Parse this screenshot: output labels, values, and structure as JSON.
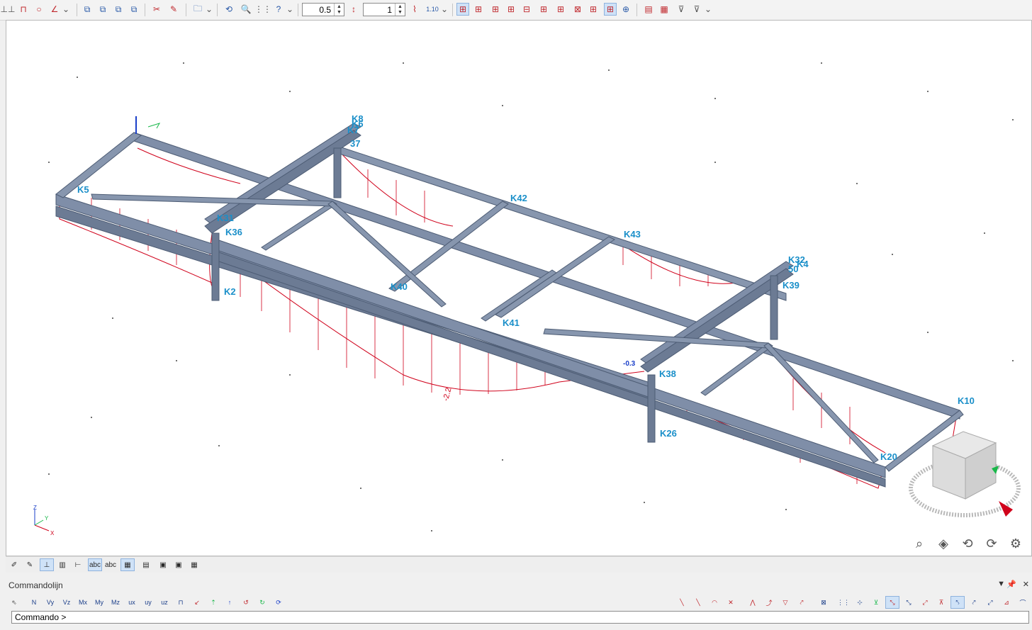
{
  "toolbar": {
    "scale_value": "0.5",
    "factor_value": "1",
    "factor_label": "1.10"
  },
  "model_labels": [
    {
      "text": "K8"
    },
    {
      "text": "K6"
    },
    {
      "text": "K7"
    },
    {
      "text": "37"
    },
    {
      "text": "K42"
    },
    {
      "text": "K43"
    },
    {
      "text": "K32"
    },
    {
      "text": "K4"
    },
    {
      "text": "50"
    },
    {
      "text": "K39"
    },
    {
      "text": "K31"
    },
    {
      "text": "K36"
    },
    {
      "text": "K2"
    },
    {
      "text": "K40"
    },
    {
      "text": "K41"
    },
    {
      "text": "K38"
    },
    {
      "text": "K26"
    },
    {
      "text": "K10"
    },
    {
      "text": "K20"
    },
    {
      "text": "K5"
    }
  ],
  "diagram_values": {
    "max_value": "-2.2",
    "end_value": "-0.3"
  },
  "axes": {
    "z": "Z",
    "y": "Y",
    "x": "X"
  },
  "command_panel": {
    "title": "Commandolijn",
    "prompt": "Commando >",
    "pin_icon": "pin-icon",
    "close_icon": "close-icon"
  },
  "command_buttons": [
    "N",
    "Vy",
    "Vz",
    "Mx",
    "My",
    "Mz",
    "ux",
    "uy",
    "uz"
  ],
  "colors": {
    "beam": "#7f8ea8",
    "beam_dark": "#56667f",
    "diagram": "#d0021b",
    "label": "#1a8fc9"
  }
}
